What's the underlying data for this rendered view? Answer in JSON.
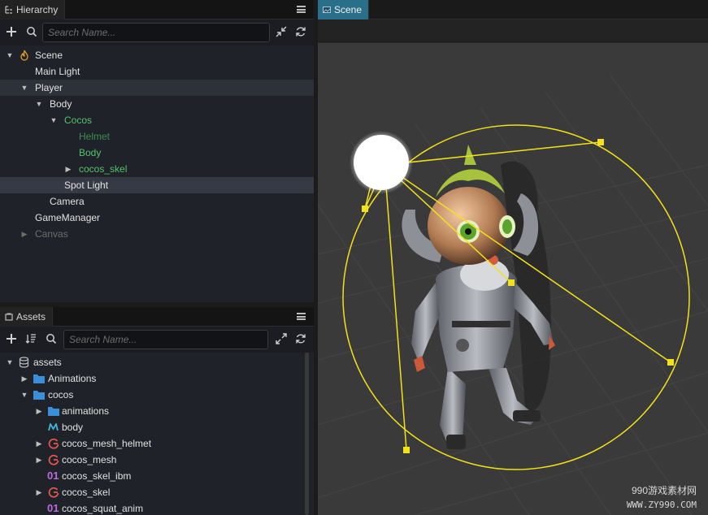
{
  "hierarchy": {
    "tab_label": "Hierarchy",
    "search_placeholder": "Search Name...",
    "items": [
      {
        "label": "Scene",
        "depth": 0,
        "expanded": true,
        "color": "#e2e2e2"
      },
      {
        "label": "Main Light",
        "depth": 1,
        "color": "#e2e2e2"
      },
      {
        "label": "Player",
        "depth": 1,
        "expanded": true,
        "selected": true,
        "color": "#e2e2e2"
      },
      {
        "label": "Body",
        "depth": 2,
        "expanded": true,
        "color": "#e2e2e2"
      },
      {
        "label": "Cocos",
        "depth": 3,
        "expanded": true,
        "color": "#56c26b"
      },
      {
        "label": "Helmet",
        "depth": 4,
        "color": "#3f8a52"
      },
      {
        "label": "Body",
        "depth": 4,
        "color": "#56c26b"
      },
      {
        "label": "cocos_skel",
        "depth": 4,
        "collapsed": true,
        "color": "#56c26b"
      },
      {
        "label": "Spot Light",
        "depth": 3,
        "selected": true,
        "color": "#e2e2e2"
      },
      {
        "label": "Camera",
        "depth": 2,
        "color": "#e2e2e2"
      },
      {
        "label": "GameManager",
        "depth": 1,
        "color": "#e2e2e2"
      },
      {
        "label": "Canvas",
        "depth": 1,
        "collapsed": true,
        "color": "#6e6e6e"
      }
    ]
  },
  "assets": {
    "tab_label": "Assets",
    "search_placeholder": "Search Name...",
    "items": [
      {
        "label": "assets",
        "icon": "database-icon"
      },
      {
        "label": "Animations",
        "icon": "folder-icon"
      },
      {
        "label": "cocos",
        "icon": "folder-icon"
      },
      {
        "label": "animations",
        "icon": "folder-icon"
      },
      {
        "label": "body",
        "icon": "mesh-icon"
      },
      {
        "label": "cocos_mesh_helmet",
        "icon": "prefab-icon"
      },
      {
        "label": "cocos_mesh",
        "icon": "prefab-icon"
      },
      {
        "label": "cocos_skel_ibm",
        "icon": "binary-icon",
        "icon_text": "01"
      },
      {
        "label": "cocos_skel",
        "icon": "prefab-icon"
      },
      {
        "label": "cocos_squat_anim",
        "icon": "binary-icon",
        "icon_text": "01"
      }
    ]
  },
  "scene": {
    "tab_label": "Scene"
  },
  "watermark": {
    "line1": "990游戏素材网",
    "line2": "WWW.ZY990.COM"
  },
  "colors": {
    "accent_tab": "#2a6f8a",
    "gizmo_yellow": "#f2e21a",
    "tree_green": "#56c26b"
  }
}
